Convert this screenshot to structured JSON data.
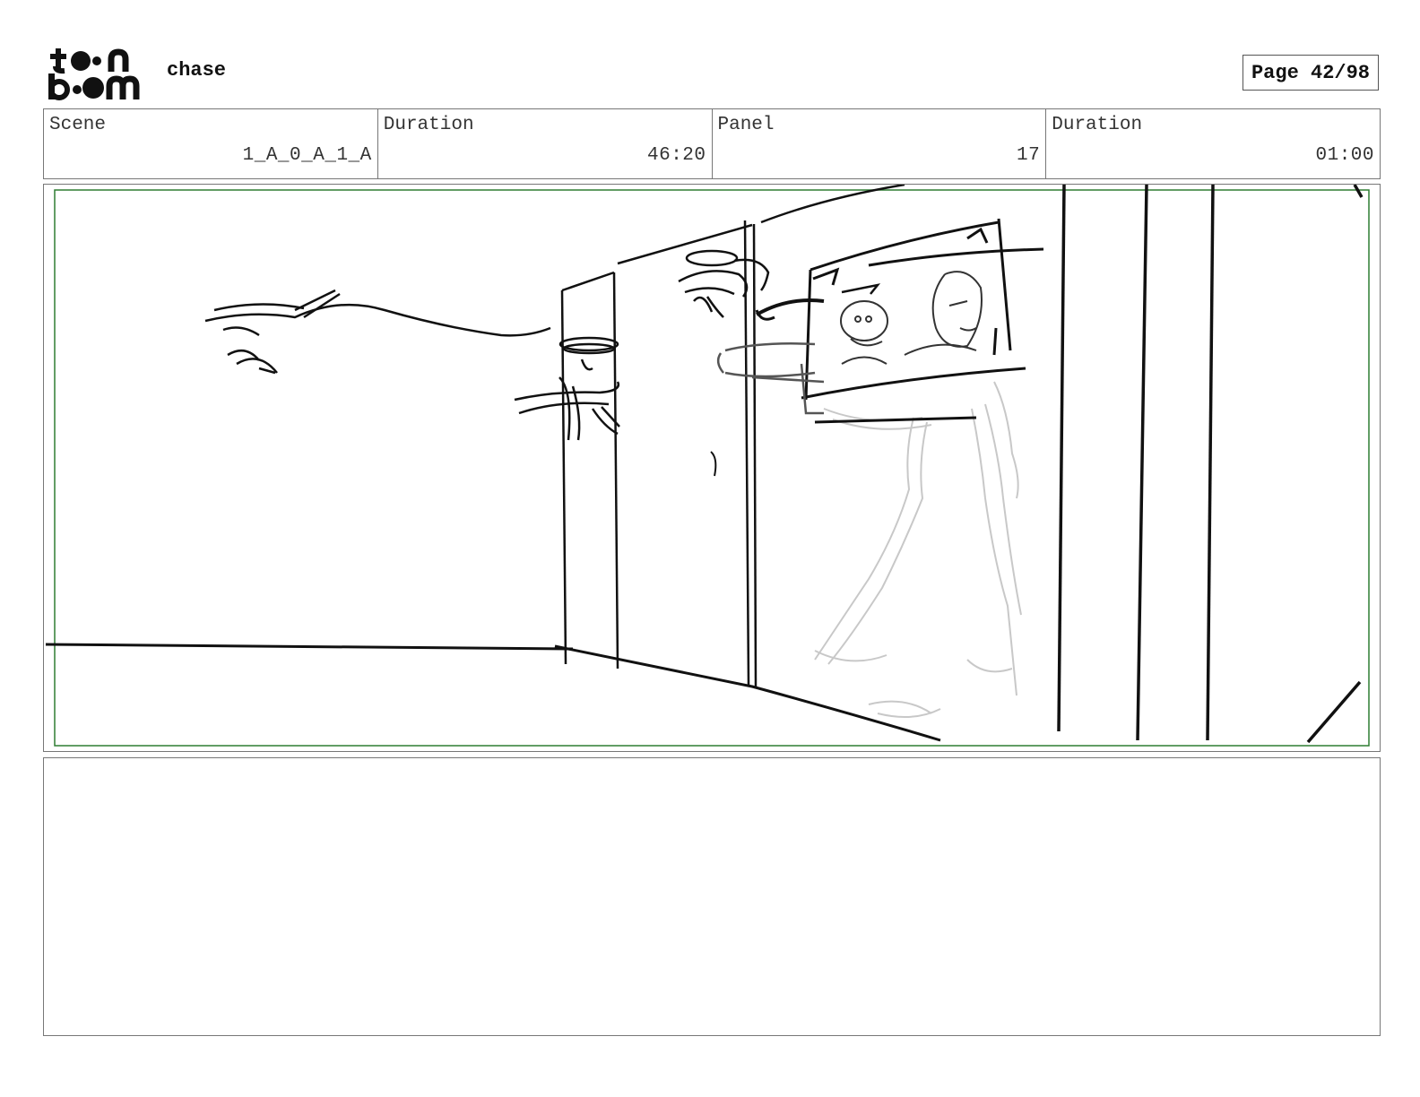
{
  "header": {
    "logo_name": "toonboom-logo",
    "project_title": "chase",
    "page_label": "Page 42/98"
  },
  "info": {
    "scene_label": "Scene",
    "scene_value": "1_A_0_A_1_A",
    "scene_duration_label": "Duration",
    "scene_duration_value": "46:20",
    "panel_label": "Panel",
    "panel_value": "17",
    "panel_duration_label": "Duration",
    "panel_duration_value": "01:00"
  },
  "colors": {
    "safe_frame": "#2e7d32",
    "border": "#777777",
    "ink": "#111111",
    "rough": "#c8c8c8"
  }
}
